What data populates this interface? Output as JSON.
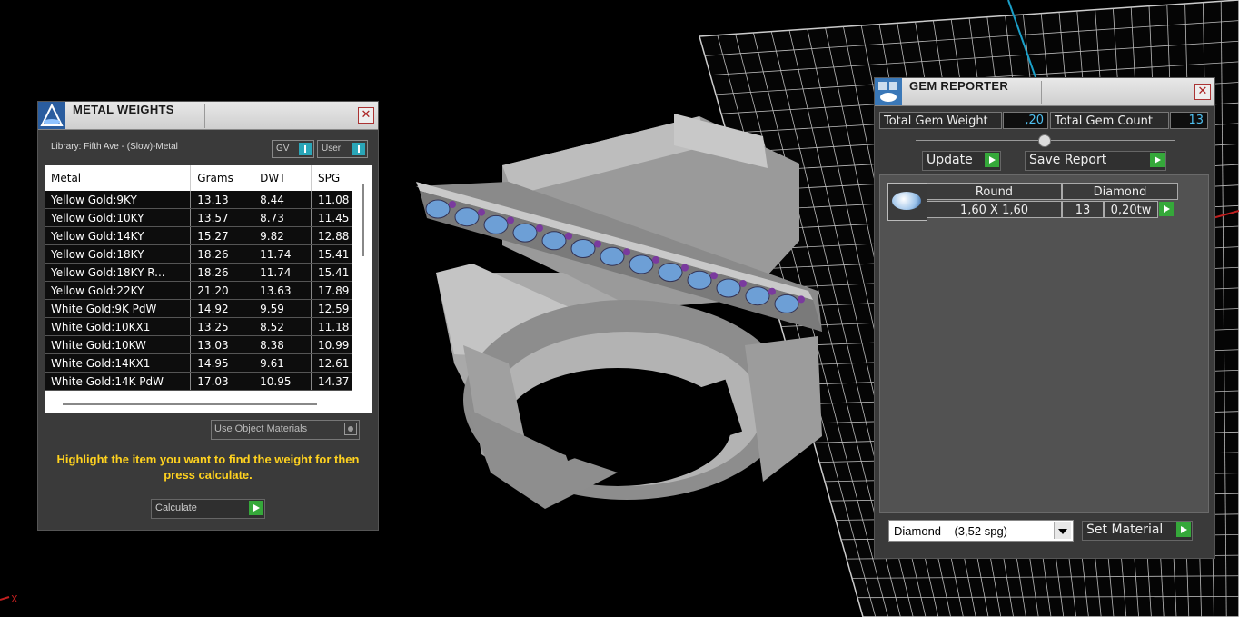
{
  "metal_weights": {
    "title": "METAL WEIGHTS",
    "library": "Library: Fifth Ave - (Slow)-Metal",
    "toggle_gv": "GV",
    "toggle_user": "User",
    "columns": [
      "Metal",
      "Grams",
      "DWT",
      "SPG"
    ],
    "rows": [
      [
        "Yellow Gold:9KY",
        "13.13",
        "8.44",
        "11.08"
      ],
      [
        "Yellow Gold:10KY",
        "13.57",
        "8.73",
        "11.45"
      ],
      [
        "Yellow Gold:14KY",
        "15.27",
        "9.82",
        "12.88"
      ],
      [
        "Yellow Gold:18KY",
        "18.26",
        "11.74",
        "15.41"
      ],
      [
        "Yellow Gold:18KY R...",
        "18.26",
        "11.74",
        "15.41"
      ],
      [
        "Yellow Gold:22KY",
        "21.20",
        "13.63",
        "17.89"
      ],
      [
        "White Gold:9K PdW",
        "14.92",
        "9.59",
        "12.59"
      ],
      [
        "White Gold:10KX1",
        "13.25",
        "8.52",
        "11.18"
      ],
      [
        "White Gold:10KW",
        "13.03",
        "8.38",
        "10.99"
      ],
      [
        "White Gold:14KX1",
        "14.95",
        "9.61",
        "12.61"
      ],
      [
        "White Gold:14K PdW",
        "17.03",
        "10.95",
        "14.37"
      ]
    ],
    "use_object_materials": "Use Object Materials",
    "hint": "Highlight the item you want to find the weight for then press calculate.",
    "calculate_label": "Calculate"
  },
  "gem_reporter": {
    "title": "GEM REPORTER",
    "total_weight_label": "Total Gem Weight",
    "total_weight_value": ",20",
    "total_count_label": "Total Gem Count",
    "total_count_value": "13",
    "update_label": "Update",
    "save_report_label": "Save Report",
    "gem": {
      "shape": "Round",
      "material": "Diamond",
      "size": "1,60 X 1,60",
      "count": "13",
      "weight": "0,20tw"
    },
    "material_select": "Diamond    (3,52 spg)",
    "set_material_label": "Set Material"
  },
  "viewport": {
    "axis_label": "X"
  }
}
